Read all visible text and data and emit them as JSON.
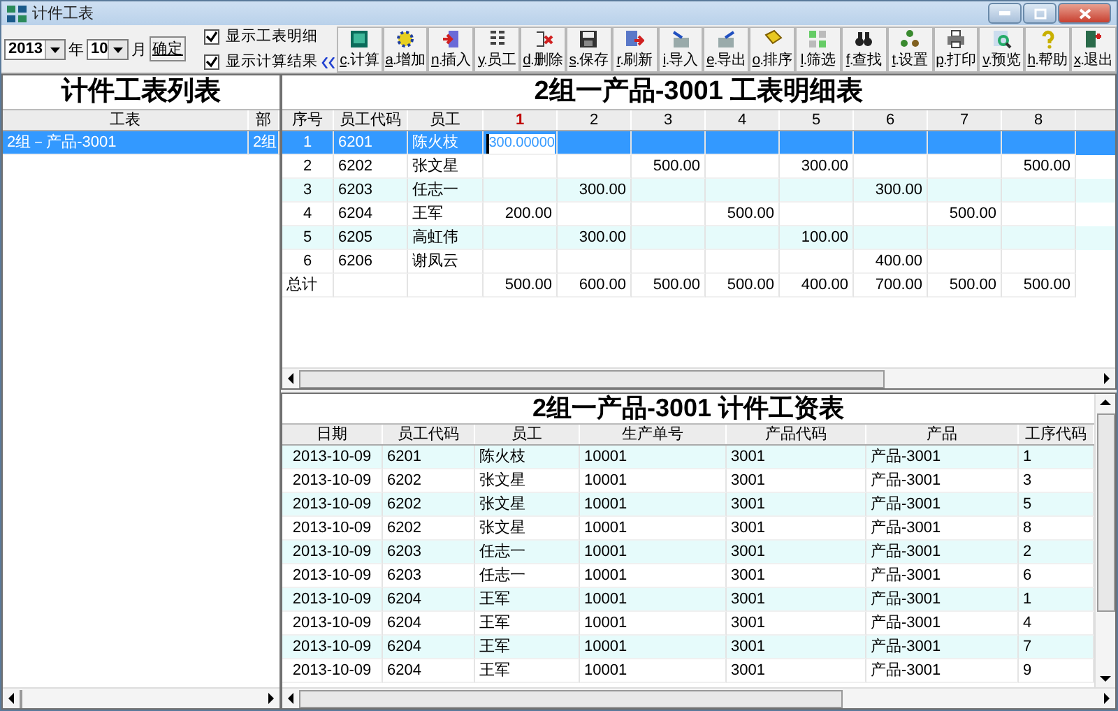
{
  "window": {
    "title": "计件工表"
  },
  "period": {
    "year": "2013",
    "year_unit": "年",
    "month": "10",
    "month_unit": "月",
    "confirm": "确定"
  },
  "options": [
    {
      "label": "显示工表明细",
      "checked": true
    },
    {
      "label": "显示计算结果",
      "checked": true
    }
  ],
  "toolbar": [
    "c.计算",
    "a.增加",
    "n.插入",
    "y.员工",
    "d.删除",
    "s.保存",
    "r.刷新",
    "i.导入",
    "e.导出",
    "o.排序",
    "l.筛选",
    "f.查找",
    "t.设置",
    "p.打印",
    "v.预览",
    "h.帮助",
    "x.退出"
  ],
  "list_panel": {
    "title": "计件工表列表",
    "columns": [
      "工表",
      "部"
    ],
    "rows": [
      {
        "cells": [
          "2组－产品-3001",
          "2组"
        ],
        "selected": true
      }
    ]
  },
  "detail": {
    "title": "2组一产品-3001 工表明细表",
    "fixed_columns": [
      "序号",
      "员工代码",
      "员工"
    ],
    "columns": [
      {
        "label": "1",
        "selected": true
      },
      {
        "label": "2",
        "selected": false
      },
      {
        "label": "3",
        "selected": false
      },
      {
        "label": "4",
        "selected": false
      },
      {
        "label": "5",
        "selected": false
      },
      {
        "label": "6",
        "selected": false
      },
      {
        "label": "7",
        "selected": false
      },
      {
        "label": "8",
        "selected": false
      }
    ],
    "rows": [
      {
        "no": "1",
        "code": "6201",
        "name": "陈火枝",
        "selected": true,
        "editing": true,
        "cells": [
          "300.00000",
          "",
          "",
          "",
          "",
          "",
          "",
          ""
        ]
      },
      {
        "no": "2",
        "code": "6202",
        "name": "张文星",
        "selected": false,
        "editing": false,
        "cells": [
          "",
          "",
          "500.00",
          "",
          "300.00",
          "",
          "",
          "500.00"
        ]
      },
      {
        "no": "3",
        "code": "6203",
        "name": "任志一",
        "selected": false,
        "editing": false,
        "cells": [
          "",
          "300.00",
          "",
          "",
          "",
          "300.00",
          "",
          ""
        ]
      },
      {
        "no": "4",
        "code": "6204",
        "name": "王军",
        "selected": false,
        "editing": false,
        "cells": [
          "200.00",
          "",
          "",
          "500.00",
          "",
          "",
          "500.00",
          ""
        ]
      },
      {
        "no": "5",
        "code": "6205",
        "name": "高虹伟",
        "selected": false,
        "editing": false,
        "cells": [
          "",
          "300.00",
          "",
          "",
          "100.00",
          "",
          "",
          ""
        ]
      },
      {
        "no": "6",
        "code": "6206",
        "name": "谢凤云",
        "selected": false,
        "editing": false,
        "cells": [
          "",
          "",
          "",
          "",
          "",
          "400.00",
          "",
          ""
        ]
      }
    ],
    "total": {
      "label": "总计",
      "cells": [
        "500.00",
        "600.00",
        "500.00",
        "500.00",
        "400.00",
        "700.00",
        "500.00",
        "500.00"
      ]
    }
  },
  "wages": {
    "title": "2组一产品-3001 计件工资表",
    "columns": [
      "日期",
      "员工代码",
      "员工",
      "生产单号",
      "产品代码",
      "产品",
      "工序代码"
    ],
    "rows": [
      [
        "2013-10-09",
        "6201",
        "陈火枝",
        "10001",
        "3001",
        "产品-3001",
        "1"
      ],
      [
        "2013-10-09",
        "6202",
        "张文星",
        "10001",
        "3001",
        "产品-3001",
        "3"
      ],
      [
        "2013-10-09",
        "6202",
        "张文星",
        "10001",
        "3001",
        "产品-3001",
        "5"
      ],
      [
        "2013-10-09",
        "6202",
        "张文星",
        "10001",
        "3001",
        "产品-3001",
        "8"
      ],
      [
        "2013-10-09",
        "6203",
        "任志一",
        "10001",
        "3001",
        "产品-3001",
        "2"
      ],
      [
        "2013-10-09",
        "6203",
        "任志一",
        "10001",
        "3001",
        "产品-3001",
        "6"
      ],
      [
        "2013-10-09",
        "6204",
        "王军",
        "10001",
        "3001",
        "产品-3001",
        "1"
      ],
      [
        "2013-10-09",
        "6204",
        "王军",
        "10001",
        "3001",
        "产品-3001",
        "4"
      ],
      [
        "2013-10-09",
        "6204",
        "王军",
        "10001",
        "3001",
        "产品-3001",
        "7"
      ],
      [
        "2013-10-09",
        "6204",
        "王军",
        "10001",
        "3001",
        "产品-3001",
        "9"
      ]
    ]
  }
}
